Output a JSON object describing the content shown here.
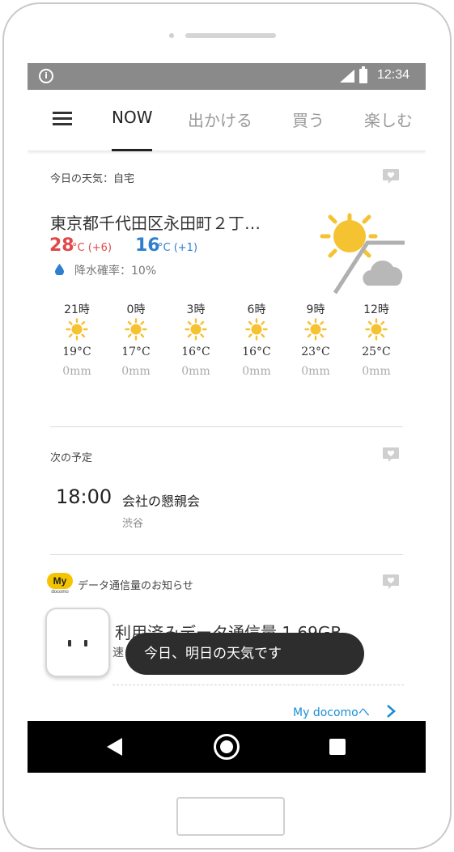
{
  "status_bar": {
    "time": "12:34",
    "info_glyph": "i"
  },
  "tabs": [
    {
      "label": "NOW",
      "active": true
    },
    {
      "label": "出かける",
      "active": false
    },
    {
      "label": "買う",
      "active": false
    },
    {
      "label": "楽しむ",
      "active": false
    }
  ],
  "weather": {
    "section_label": "今日の天気：自宅",
    "address": "東京都千代田区永田町２丁…",
    "high_temp": "28",
    "high_unit": "°C (+6)",
    "low_temp": "16",
    "low_unit": "°C (+1)",
    "rain_chance": "降水確率：10%",
    "forecast_icon": "sunny-then-cloudy",
    "hourly": [
      {
        "hour": "21時",
        "temp": "19°C",
        "precip": "0mm",
        "icon": "sun-icon"
      },
      {
        "hour": "0時",
        "temp": "17°C",
        "precip": "0mm",
        "icon": "sun-icon"
      },
      {
        "hour": "3時",
        "temp": "16°C",
        "precip": "0mm",
        "icon": "sun-icon"
      },
      {
        "hour": "6時",
        "temp": "16°C",
        "precip": "0mm",
        "icon": "sun-icon"
      },
      {
        "hour": "9時",
        "temp": "23°C",
        "precip": "0mm",
        "icon": "sun-icon"
      },
      {
        "hour": "12時",
        "temp": "25°C",
        "precip": "0mm",
        "icon": "sun-icon"
      }
    ]
  },
  "schedule": {
    "section_label": "次の予定",
    "time": "18:00",
    "title": "会社の懇親会",
    "place": "渋谷"
  },
  "data_notice": {
    "badge_text": "My",
    "badge_sub": "docomo",
    "section_label": "データ通信量のお知らせ",
    "title": "利用済みデータ通信量 1.69GB",
    "subtitle": "速",
    "link": "My docomoへ"
  },
  "tooltip": {
    "text": "今日、明日の天気です"
  },
  "colors": {
    "status_bar": "#8a8a8a",
    "high_temp": "#e04848",
    "low_temp": "#2f7fd0",
    "sun": "#f5c231",
    "link": "#1a8fd6",
    "badge": "#f5c400",
    "nav_bar": "#000000"
  }
}
